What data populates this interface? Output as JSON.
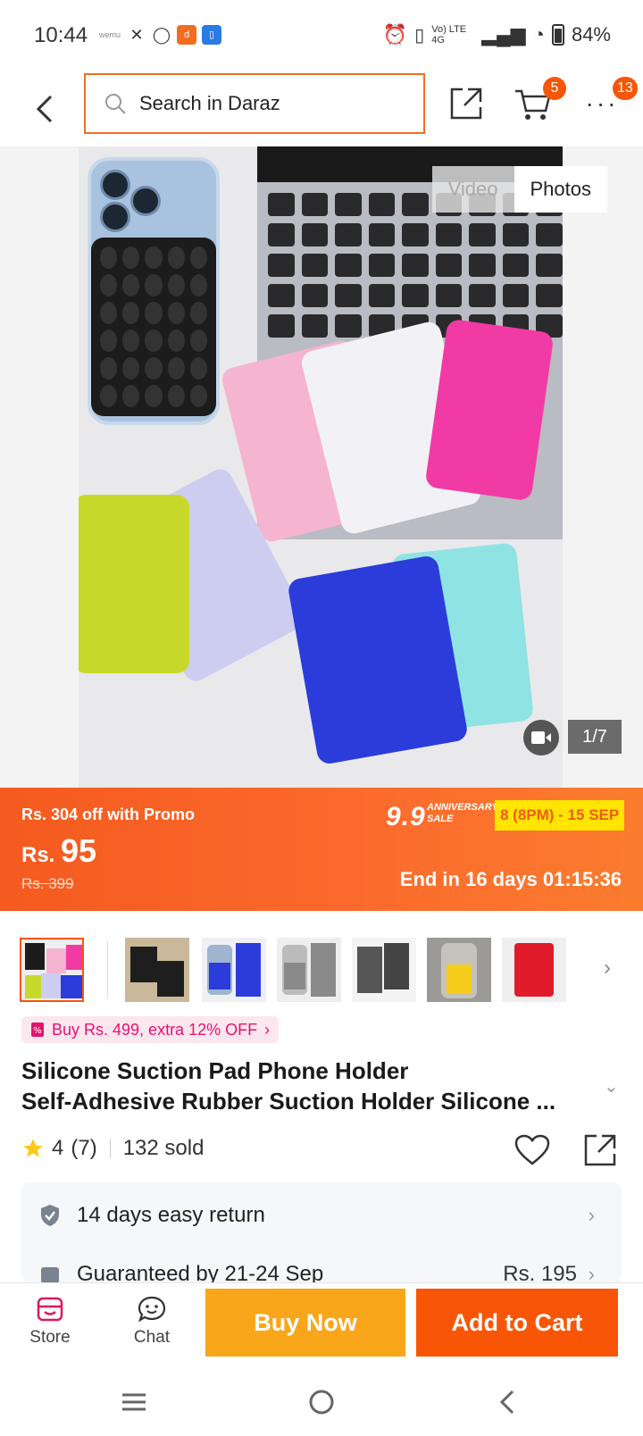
{
  "status_bar": {
    "time": "10:44",
    "app_icons": [
      "wemu",
      "x",
      "whatsapp",
      "daraz-app",
      "calendar-app"
    ],
    "network": "Vo) LTE 4G",
    "battery": "84%"
  },
  "search": {
    "placeholder": "Search in Daraz"
  },
  "header": {
    "cart_count": "5",
    "more_count": "13"
  },
  "media": {
    "tab_video": "Video",
    "tab_photos": "Photos",
    "counter": "1/7",
    "active_tab": "Photos"
  },
  "promo": {
    "off_text": "Rs. 304 off with Promo",
    "price_prefix": "Rs.",
    "price": "95",
    "old_price": "Rs. 399",
    "event_big": "9.9",
    "event_small_1": "ANNIVERSARY",
    "event_small_2": "SALE",
    "event_dates": "8 (8PM) - 15 SEP",
    "ends_in": "End in 16 days 01:15:36"
  },
  "thumbnails": {
    "count": 7,
    "active_index": 0
  },
  "product": {
    "voucher": "Buy Rs. 499, extra 12% OFF",
    "title_line1": "Silicone Suction Pad Phone Holder",
    "title_line2": "Self-Adhesive Rubber Suction Holder Silicone ...",
    "rating": "4",
    "rating_count": "(7)",
    "sold": "132 sold"
  },
  "services": {
    "return_text": "14 days easy return",
    "delivery_text": "Guaranteed by 21-24 Sep",
    "delivery_price": "Rs. 195"
  },
  "actions": {
    "store_label": "Store",
    "chat_label": "Chat",
    "buy_now": "Buy Now",
    "add_to_cart": "Add to Cart"
  },
  "colors": {
    "brand_orange": "#f85606",
    "buy_now_yellow": "#faa61a",
    "promo_yellow": "#ffe500",
    "voucher_pink": "#e2136e"
  }
}
